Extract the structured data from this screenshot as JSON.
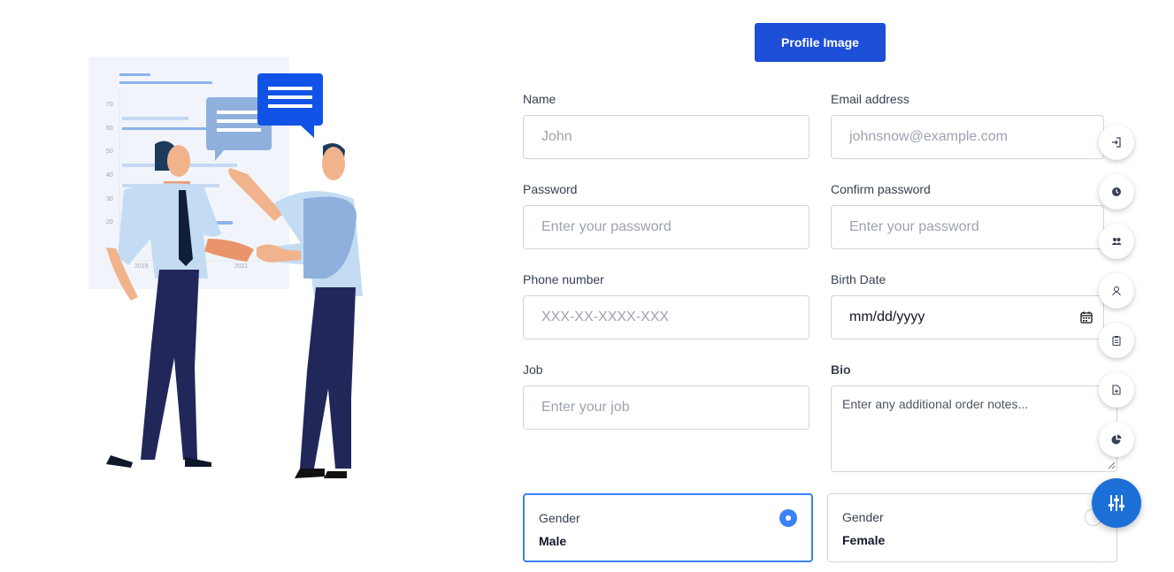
{
  "header": {
    "profile_button": "Profile Image"
  },
  "form": {
    "name": {
      "label": "Name",
      "placeholder": "John"
    },
    "email": {
      "label": "Email address",
      "placeholder": "johnsnow@example.com"
    },
    "password": {
      "label": "Password",
      "placeholder": "Enter your password"
    },
    "confirm_password": {
      "label": "Confirm password",
      "placeholder": "Enter your password"
    },
    "phone": {
      "label": "Phone number",
      "placeholder": "XXX-XX-XXXX-XXX"
    },
    "birth_date": {
      "label": "Birth Date",
      "value": "mm/dd/yyyy"
    },
    "job": {
      "label": "Job",
      "placeholder": "Enter your job"
    },
    "bio": {
      "label": "Bio",
      "placeholder": "Enter any additional order notes..."
    },
    "gender_male": {
      "label": "Gender",
      "value": "Male",
      "selected": true
    },
    "gender_female": {
      "label": "Gender",
      "value": "Female",
      "selected": false
    }
  },
  "illustration": {
    "chart_ticks": [
      "70",
      "60",
      "50",
      "40",
      "30",
      "20"
    ],
    "years": [
      "2019",
      "2021"
    ]
  },
  "side_toolbar": {
    "icons": [
      "sign-in-icon",
      "clock-icon",
      "users-icon",
      "user-icon",
      "clipboard-icon",
      "file-plus-icon",
      "pie-chart-icon"
    ],
    "fab_icon": "sliders-icon"
  },
  "colors": {
    "primary": "#1d4ed8",
    "accent": "#3b82f6",
    "fab": "#1d6fd8"
  }
}
